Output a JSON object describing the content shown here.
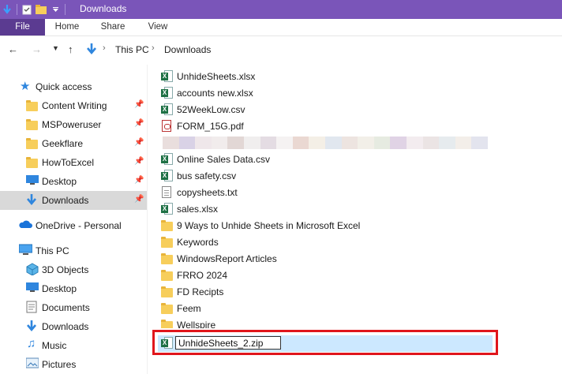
{
  "window": {
    "title": "Downloads"
  },
  "ribbon": {
    "tabs": [
      "File",
      "Home",
      "Share",
      "View"
    ]
  },
  "address": {
    "crumbs": [
      "This PC",
      "Downloads"
    ],
    "separator": ">"
  },
  "nav": {
    "quick_access": "Quick access",
    "pinned": [
      "Content Writing",
      "MSPoweruser",
      "Geekflare",
      "HowToExcel",
      "Desktop",
      "Downloads"
    ],
    "onedrive": "OneDrive - Personal",
    "this_pc": "This PC",
    "pc_items": [
      "3D Objects",
      "Desktop",
      "Documents",
      "Downloads",
      "Music",
      "Pictures"
    ]
  },
  "files": [
    {
      "name": "UnhideSheets.xlsx",
      "icon": "excel-icon"
    },
    {
      "name": "accounts new.xlsx",
      "icon": "excel-icon"
    },
    {
      "name": "52WeekLow.csv",
      "icon": "excel-icon"
    },
    {
      "name": "FORM_15G.pdf",
      "icon": "pdf-icon"
    },
    {
      "name": "",
      "icon": "blurred"
    },
    {
      "name": "Online Sales Data.csv",
      "icon": "excel-icon"
    },
    {
      "name": "bus safety.csv",
      "icon": "excel-icon"
    },
    {
      "name": "copysheets.txt",
      "icon": "text-file-icon"
    },
    {
      "name": "sales.xlsx",
      "icon": "excel-icon"
    },
    {
      "name": "9 Ways to Unhide Sheets in Microsoft Excel",
      "icon": "folder-icon"
    },
    {
      "name": "Keywords",
      "icon": "folder-icon"
    },
    {
      "name": "WindowsReport Articles",
      "icon": "folder-icon"
    },
    {
      "name": "FRRO 2024",
      "icon": "folder-icon"
    },
    {
      "name": "FD Recipts",
      "icon": "folder-icon"
    },
    {
      "name": "Feem",
      "icon": "folder-icon"
    },
    {
      "name": "Wellspire",
      "icon": "folder-icon"
    }
  ],
  "rename": {
    "value": "UnhideSheets_2.zip"
  },
  "colors": {
    "titlebar": "#7a55b9",
    "file_tab": "#5b3b91",
    "selection": "#cce8ff",
    "highlight": "#e0161c"
  }
}
